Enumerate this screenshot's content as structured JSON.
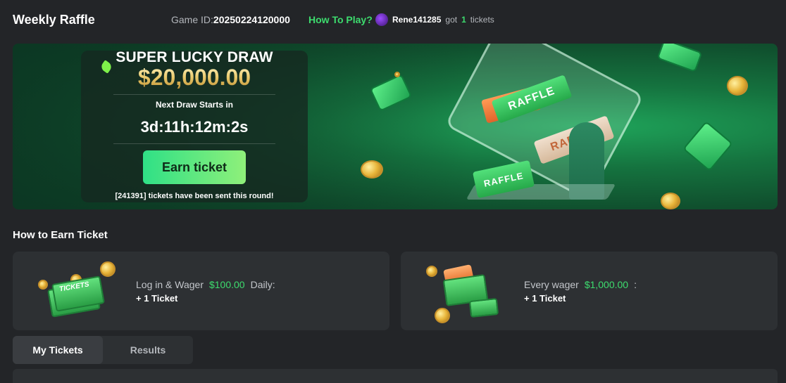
{
  "header": {
    "title": "Weekly Raffle",
    "game_id_label": "Game ID:",
    "game_id_value": "20250224120000",
    "how_to_play": "How To Play?",
    "winner": {
      "username": "Rene141285",
      "got": "got",
      "count": "1",
      "suffix": "tickets"
    }
  },
  "banner": {
    "title": "SUPER LUCKY DRAW",
    "prize": "$20,000.00",
    "next_label": "Next Draw Starts in",
    "countdown": "3d:11h:12m:2s",
    "earn_button": "Earn ticket",
    "sent_text": "[241391] tickets have been sent this round!",
    "illustration_tickets": [
      "RAFFLE",
      "RAFFLE",
      "RAFFLE"
    ]
  },
  "how_to_earn": {
    "title": "How to Earn Ticket",
    "cards": [
      {
        "prefix": "Log in & Wager",
        "amount": "$100.00",
        "suffix": "Daily:",
        "reward": "+ 1 Ticket",
        "image_label": "TICKETS"
      },
      {
        "prefix": "Every wager",
        "amount": "$1,000.00",
        "suffix": ":",
        "reward": "+ 1 Ticket"
      }
    ]
  },
  "tabs": [
    {
      "label": "My Tickets",
      "active": true
    },
    {
      "label": "Results",
      "active": false
    }
  ],
  "colors": {
    "accent": "#3ddc6e",
    "bg": "#232528",
    "card": "#2d3033",
    "gold": "#e9c86a"
  }
}
